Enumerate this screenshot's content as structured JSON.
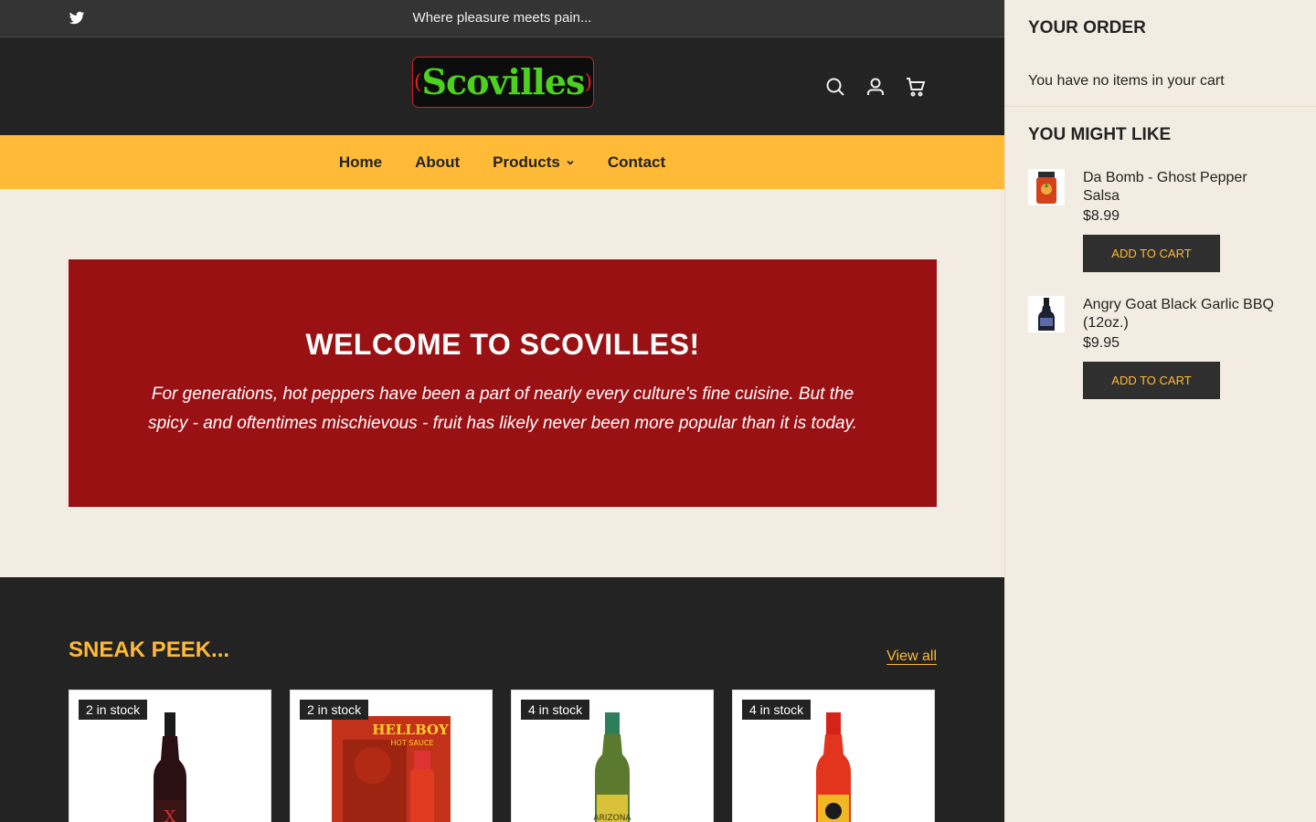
{
  "topbar": {
    "announcement": "Where pleasure meets pain..."
  },
  "logo": {
    "text": "Scovilles"
  },
  "nav": {
    "items": [
      "Home",
      "About",
      "Products",
      "Contact"
    ]
  },
  "hero": {
    "title": "WELCOME TO SCOVILLES!",
    "text": "For generations, hot peppers have been a part of nearly every culture's fine cuisine. But the spicy - and oftentimes mischievous - fruit has likely never been more popular than it is today."
  },
  "sneak": {
    "title": "SNEAK PEEK...",
    "view_all": "View all",
    "cards": [
      {
        "badge": "2 in stock"
      },
      {
        "badge": "2 in stock"
      },
      {
        "badge": "4 in stock"
      },
      {
        "badge": "4 in stock"
      }
    ]
  },
  "cart": {
    "title": "YOUR ORDER",
    "empty": "You have no items in your cart",
    "like_title": "YOU MIGHT LIKE",
    "items": [
      {
        "name": "Da Bomb - Ghost Pepper Salsa",
        "price": "$8.99",
        "button": "ADD TO CART"
      },
      {
        "name": "Angry Goat Black Garlic BBQ (12oz.)",
        "price": "$9.95",
        "button": "ADD TO CART"
      }
    ]
  },
  "colors": {
    "accent": "#ffbb38",
    "dark": "#232323",
    "hero": "#9a1114",
    "cream": "#f3ece2"
  }
}
